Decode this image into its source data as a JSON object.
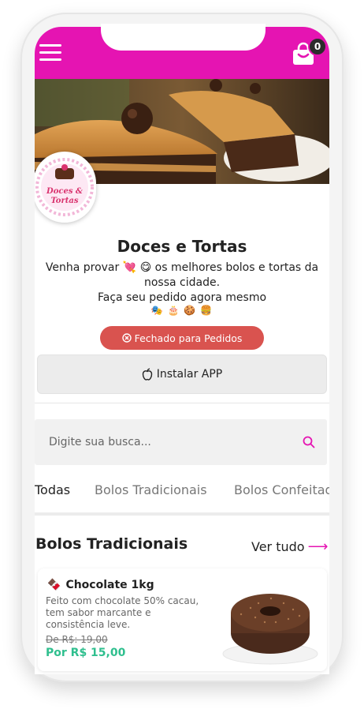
{
  "header": {
    "cart_count": "0",
    "accent_color": "#e514b2"
  },
  "store": {
    "name": "Doces e Tortas",
    "desc_line1": "Venha provar 💘 😋  os melhores bolos e tortas da nossa cidade.",
    "desc_line2": "Faça seu pedido agora mesmo",
    "emoji_line": "🎭 🎂 🍪 🍔",
    "logo_text": "Doces & Tortas"
  },
  "buttons": {
    "closed": "Fechado para Pedidos",
    "install": "Instalar APP"
  },
  "search": {
    "placeholder": "Digite sua busca..."
  },
  "tabs": [
    {
      "label": "Todas"
    },
    {
      "label": "Bolos Tradicionais"
    },
    {
      "label": "Bolos Confeitados"
    }
  ],
  "section": {
    "title": "Bolos Tradicionais",
    "see_all": "Ver tudo"
  },
  "product": {
    "emoji": "🍫",
    "name": "Chocolate 1kg",
    "desc": "Feito com chocolate 50% cacau, tem sabor marcante e consistência leve.",
    "old_price": "De R$: 19,00",
    "new_price": "Por R$ 15,00"
  }
}
